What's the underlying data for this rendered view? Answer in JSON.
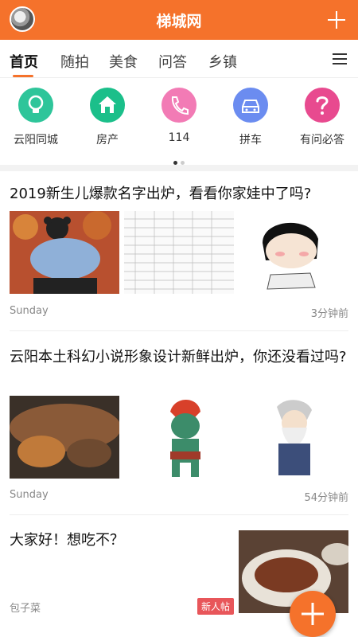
{
  "header": {
    "title": "梯城网"
  },
  "tabs": [
    {
      "label": "首页",
      "active": true
    },
    {
      "label": "随拍"
    },
    {
      "label": "美食"
    },
    {
      "label": "问答"
    },
    {
      "label": "乡镇"
    }
  ],
  "shortcuts": [
    {
      "label": "云阳同城",
      "icon": "lightbulb-icon",
      "color": "#2ec59a"
    },
    {
      "label": "房产",
      "icon": "house-icon",
      "color": "#1bbf8a"
    },
    {
      "label": "114",
      "icon": "phone-icon",
      "color": "#f27bb5"
    },
    {
      "label": "拼车",
      "icon": "car-icon",
      "color": "#6b8cf0"
    },
    {
      "label": "有问必答",
      "icon": "question-icon",
      "color": "#e84a8f"
    }
  ],
  "articles": [
    {
      "title": "2019新生儿爆款名字出炉，看看你家娃中了吗?",
      "source": "Sunday",
      "time": "3分钟前"
    },
    {
      "title": "云阳本土科幻小说形象设计新鲜出炉，你还没看过吗?",
      "source": "Sunday",
      "time": "54分钟前"
    },
    {
      "title": "大家好！想吃不？",
      "source": "包子菜",
      "badge": "新人帖"
    }
  ],
  "colors": {
    "accent": "#f5722b"
  }
}
